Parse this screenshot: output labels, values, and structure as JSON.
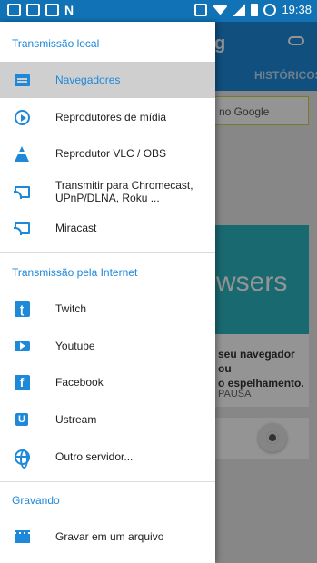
{
  "status_bar": {
    "time": "19:38"
  },
  "app": {
    "title_fragment": "g",
    "tab_hist": "HISTÓRICOS",
    "search_placeholder": "no Google",
    "banner_text": "wsers",
    "card_text_line1": "seu navegador ou",
    "card_text_line2": "o espelhamento.",
    "card_pause": "PAUSA"
  },
  "drawer": {
    "sections": [
      {
        "header": "Transmissão local",
        "items": [
          {
            "label": "Navegadores",
            "icon": "browser-icon",
            "active": true
          },
          {
            "label": "Reprodutores de mídia",
            "icon": "play-circle-icon"
          },
          {
            "label": "Reprodutor VLC / OBS",
            "icon": "vlc-cone-icon"
          },
          {
            "label": "Transmitir para Chromecast, UPnP/DLNA, Roku ...",
            "icon": "cast-icon"
          },
          {
            "label": "Miracast",
            "icon": "cast-icon"
          }
        ]
      },
      {
        "header": "Transmissão pela Internet",
        "items": [
          {
            "label": "Twitch",
            "icon": "twitch-icon"
          },
          {
            "label": "Youtube",
            "icon": "youtube-icon"
          },
          {
            "label": "Facebook",
            "icon": "facebook-icon"
          },
          {
            "label": "Ustream",
            "icon": "ustream-icon"
          },
          {
            "label": "Outro servidor...",
            "icon": "globe-icon"
          }
        ]
      },
      {
        "header": "Gravando",
        "items": [
          {
            "label": "Gravar em um arquivo",
            "icon": "clapperboard-icon"
          }
        ]
      }
    ]
  },
  "colors": {
    "accent": "#1e88d9",
    "status_bar": "#1173b5",
    "active_bg": "#cfcfcf",
    "banner": "#2bb5c1"
  }
}
